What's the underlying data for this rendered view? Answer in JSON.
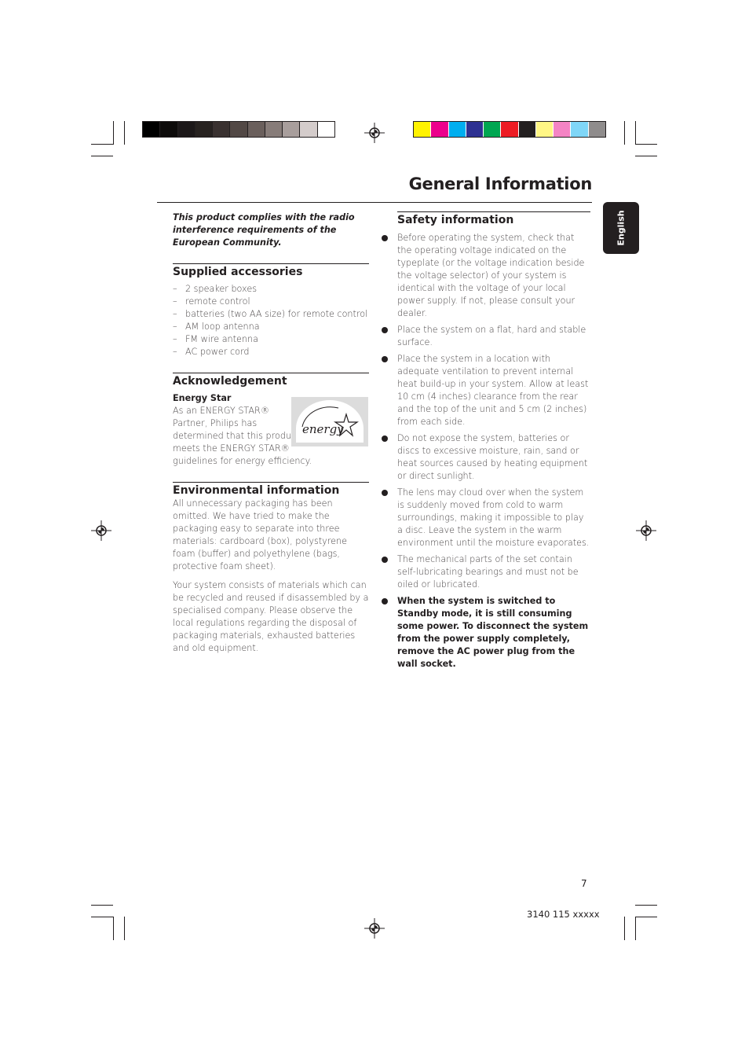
{
  "page": {
    "title": "General Information",
    "language_tab": "English",
    "page_number": "7",
    "document_code": "3140 115 xxxxx"
  },
  "color_bars": {
    "grayscale": [
      "#000000",
      "#0d0b0a",
      "#1c1819",
      "#272220",
      "#393130",
      "#524845",
      "#6a5f5c",
      "#877c79",
      "#a89e9c",
      "#d4cccb",
      "#ffffff"
    ],
    "process": [
      "#fff200",
      "#ec008c",
      "#00aeef",
      "#2e3192",
      "#00a651",
      "#ed1c24",
      "#231f20",
      "#fff685",
      "#f484c4",
      "#7fd6f7",
      "#8f8c8c"
    ]
  },
  "left_column": {
    "intro": "This product complies with the radio interference requirements of the European Community.",
    "supplied_accessories": {
      "heading": "Supplied accessories",
      "items": [
        "2 speaker boxes",
        "remote control",
        "batteries (two AA size) for remote control",
        "AM loop antenna",
        "FM wire antenna",
        "AC power cord"
      ]
    },
    "acknowledgement": {
      "heading": "Acknowledgement",
      "subheading": "Energy Star",
      "text_lines": [
        "As an ENERGY STAR®",
        "Partner, Philips has",
        "determined that this product",
        "meets the ENERGY STAR®",
        "guidelines for energy efficiency."
      ],
      "logo_text": "energy"
    },
    "environmental": {
      "heading": "Environmental information",
      "paragraphs": [
        "All unnecessary packaging has been omitted. We have tried to make the packaging easy to separate into three materials: cardboard (box), polystyrene foam (buffer) and polyethylene (bags, protective foam sheet).",
        "Your system consists of materials which can be recycled and reused if disassembled by a specialised company. Please observe the local regulations regarding the disposal of packaging materials, exhausted batteries and old equipment."
      ]
    }
  },
  "right_column": {
    "safety": {
      "heading": "Safety information",
      "items": [
        "Before operating the system, check that the operating voltage indicated on the typeplate (or the voltage indication beside the voltage selector) of your system is identical with the voltage of your local power supply. If not, please consult your dealer.",
        "Place the system on a flat, hard and stable surface.",
        "Place the system in a location with adequate ventilation to prevent internal heat build-up in your system.  Allow at least 10 cm (4 inches) clearance from the rear and the top of the unit and 5 cm (2 inches) from each side.",
        "Do not expose the system, batteries or discs to excessive moisture, rain, sand or heat sources caused by heating equipment or direct sunlight.",
        "The lens may cloud over when the system is suddenly moved from cold to warm surroundings, making it impossible to play a disc. Leave the system in the warm environment until the moisture evaporates.",
        "The mechanical parts of the set contain self-lubricating bearings and must not be oiled or lubricated."
      ],
      "warning": "When the system is switched to Standby mode, it is still consuming some power. To disconnect the system from the power supply completely, remove the AC power plug from the wall socket."
    }
  }
}
